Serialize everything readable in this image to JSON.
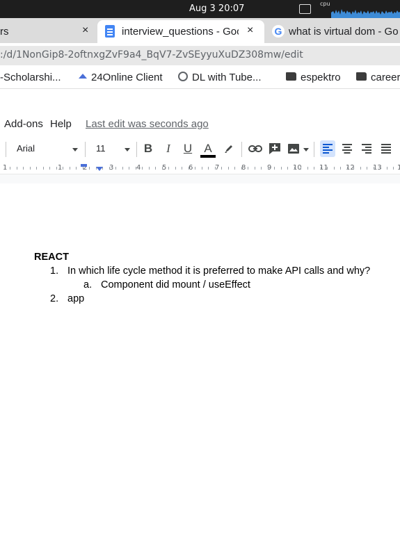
{
  "system_bar": {
    "clock": "Aug 3  20:07",
    "cpu_label": "cpu"
  },
  "tabs": [
    {
      "title": "rs",
      "close": "×"
    },
    {
      "title": "interview_questions - Goo",
      "close": "×",
      "active": true
    },
    {
      "title": "what is virtual dom - Go",
      "close": ""
    }
  ],
  "address_bar": {
    "url": ":/d/1NonGip8-2oftnxgZvF9a4_BqV7-ZvSEyyuXuDZ308mw/edit"
  },
  "bookmarks": [
    {
      "label": "-Scholarshi...",
      "icon": "none"
    },
    {
      "label": "24Online Client",
      "icon": "triangle-icon"
    },
    {
      "label": "DL with Tube...",
      "icon": "globe-icon"
    },
    {
      "label": "espektro",
      "icon": "folder-icon"
    },
    {
      "label": "career",
      "icon": "folder-icon"
    }
  ],
  "menubar": {
    "items": [
      "Add-ons",
      "Help"
    ],
    "last_edit": "Last edit was seconds ago"
  },
  "toolbar": {
    "font": "Arial",
    "size": "11",
    "bold": "B",
    "italic": "I",
    "underline": "U",
    "text_color": "A",
    "text_color_value": "#000000"
  },
  "ruler": {
    "numbers": [
      "1",
      "1",
      "2",
      "3",
      "4",
      "5",
      "6",
      "7",
      "8",
      "9",
      "10",
      "11",
      "12",
      "13",
      "1"
    ]
  },
  "document": {
    "heading": "REACT",
    "items": [
      {
        "marker": "1.",
        "text": "In which life cycle method it is preferred to make API calls and why?"
      },
      {
        "marker": "a.",
        "text": "Component did mount /  useEffect"
      },
      {
        "marker": "2.",
        "text": "app"
      }
    ]
  },
  "colors": {
    "accent": "#4a6fd8",
    "docs_blue": "#4285f4",
    "system_bar": "#1e1e1e"
  }
}
